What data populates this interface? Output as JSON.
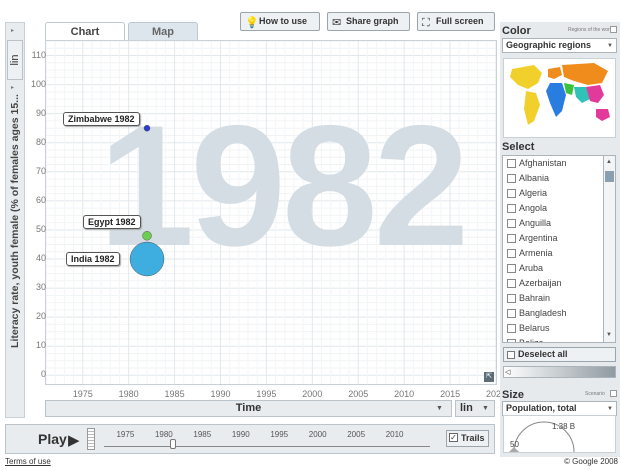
{
  "tabs": [
    {
      "label": "Chart"
    },
    {
      "label": "Map"
    }
  ],
  "toolbar": {
    "how_to_use": "How to use",
    "share_graph": "Share graph",
    "full_screen": "Full screen"
  },
  "y_axis": {
    "scale": "lin",
    "title": "Literacy rate, youth female (% of females ages 15...",
    "ticks": [
      "110",
      "100",
      "90",
      "80",
      "70",
      "60",
      "50",
      "40",
      "30",
      "20",
      "10",
      "0"
    ]
  },
  "x_axis": {
    "title": "Time",
    "scale": "lin",
    "ticks": [
      "1975",
      "1980",
      "1985",
      "1990",
      "1995",
      "2000",
      "2005",
      "2010",
      "2015",
      "2020"
    ]
  },
  "current_year": "1982",
  "chart_data": {
    "type": "scatter",
    "year": "1982",
    "xlabel": "Time",
    "ylabel": "Literacy rate, youth female (% of females ages 15...",
    "xlim": [
      1971,
      2020
    ],
    "ylim": [
      -3,
      115
    ],
    "points": [
      {
        "label": "Zimbabwe 1982",
        "x": 1982,
        "y": 85,
        "size": 0.02,
        "color": "#2233cc"
      },
      {
        "label": "Egypt 1982",
        "x": 1982,
        "y": 48,
        "size": 0.05,
        "color": "#66cc44"
      },
      {
        "label": "India 1982",
        "x": 1982,
        "y": 40,
        "size": 0.72,
        "color": "#33aadd"
      }
    ]
  },
  "playback": {
    "play_label": "Play",
    "timeline_ticks": [
      "1975",
      "1980",
      "1985",
      "1990",
      "1995",
      "2000",
      "2005",
      "2010"
    ],
    "trails_label": "Trails"
  },
  "color_panel": {
    "title": "Color",
    "subtitle": "Regions of the world",
    "selected": "Geographic regions"
  },
  "select_panel": {
    "title": "Select",
    "countries": [
      "Afghanistan",
      "Albania",
      "Algeria",
      "Angola",
      "Anguilla",
      "Argentina",
      "Armenia",
      "Aruba",
      "Azerbaijan",
      "Bahrain",
      "Bangladesh",
      "Belarus",
      "Belize"
    ],
    "deselect_all": "Deselect all"
  },
  "size_panel": {
    "title": "Size",
    "subtitle": "Scenario",
    "selected": "Population, total",
    "legend_max": "1.38 B",
    "legend_min": "50"
  },
  "footer": {
    "terms": "Terms of use",
    "copyright": "© Google 2008"
  }
}
